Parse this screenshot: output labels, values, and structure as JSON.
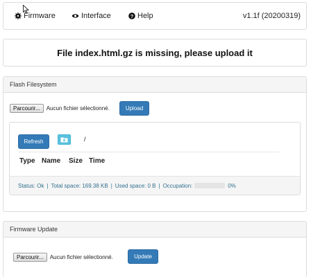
{
  "navbar": {
    "items": [
      {
        "label": "Firmware",
        "icon": "gear-icon"
      },
      {
        "label": "Interface",
        "icon": "eye-icon"
      },
      {
        "label": "Help",
        "icon": "question-circle-icon"
      }
    ],
    "version": "v1.1f (20200319)"
  },
  "alert": {
    "message": "File index.html.gz is missing, please upload it"
  },
  "flash": {
    "title": "Flash Filesystem",
    "file_button": "Parcourir...",
    "file_status": "Aucun fichier sélectionné.",
    "upload_label": "Upload",
    "refresh_label": "Refresh",
    "path": "/",
    "columns": [
      "Type",
      "Name",
      "Size",
      "Time"
    ],
    "status": {
      "label": "Status: Ok",
      "total": "Total space: 169.38 KB",
      "used": "Used space: 0 B",
      "occupation_label": "Occupation:",
      "occupation_value": "0%",
      "occupation_fraction": 0
    }
  },
  "firmware": {
    "title": "Firmware Update",
    "file_button": "Parcourir...",
    "file_status": "Aucun fichier sélectionné.",
    "update_label": "Update"
  },
  "colors": {
    "primary": "#337ab7",
    "info": "#5bc0de",
    "status_text": "#31708f"
  }
}
